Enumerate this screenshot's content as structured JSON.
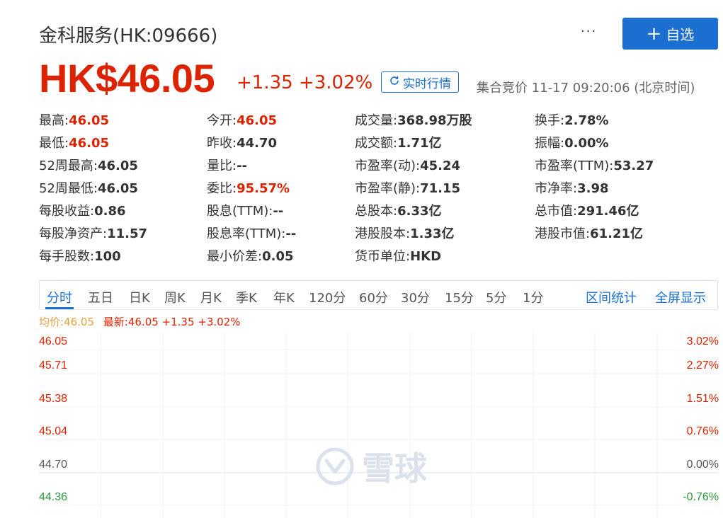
{
  "header": {
    "title": "金科服务(HK:09666)",
    "more": "···",
    "follow_plus": "+",
    "follow_label": "自选"
  },
  "quote": {
    "price": "HK$46.05",
    "change": "+1.35 +3.02%",
    "realtime_icon": "refresh-icon",
    "realtime_label": "实时行情",
    "auction_status": "集合竞价 11-17 09:20:06 (北京时间)"
  },
  "stats": [
    [
      {
        "label": "最高:",
        "value": "46.05",
        "color": "red"
      },
      {
        "label": "今开:",
        "value": "46.05",
        "color": "red"
      },
      {
        "label": "成交量:",
        "value": "368.98万股",
        "color": "normal"
      },
      {
        "label": "换手:",
        "value": "2.78%",
        "color": "normal"
      }
    ],
    [
      {
        "label": "最低:",
        "value": "46.05",
        "color": "red"
      },
      {
        "label": "昨收:",
        "value": "44.70",
        "color": "normal"
      },
      {
        "label": "成交额:",
        "value": "1.71亿",
        "color": "normal"
      },
      {
        "label": "振幅:",
        "value": "0.00%",
        "color": "normal"
      }
    ],
    [
      {
        "label": "52周最高:",
        "value": "46.05",
        "color": "normal"
      },
      {
        "label": "量比:",
        "value": "--",
        "color": "normal"
      },
      {
        "label": "市盈率(动):",
        "value": "45.24",
        "color": "normal"
      },
      {
        "label": "市盈率(TTM):",
        "value": "53.27",
        "color": "normal"
      }
    ],
    [
      {
        "label": "52周最低:",
        "value": "46.05",
        "color": "normal"
      },
      {
        "label": "委比:",
        "value": "95.57%",
        "color": "red"
      },
      {
        "label": "市盈率(静):",
        "value": "71.15",
        "color": "normal"
      },
      {
        "label": "市净率:",
        "value": "3.98",
        "color": "normal"
      }
    ],
    [
      {
        "label": "每股收益:",
        "value": "0.86",
        "color": "normal"
      },
      {
        "label": "股息(TTM):",
        "value": "--",
        "color": "normal"
      },
      {
        "label": "总股本:",
        "value": "6.33亿",
        "color": "normal"
      },
      {
        "label": "总市值:",
        "value": "291.46亿",
        "color": "normal"
      }
    ],
    [
      {
        "label": "每股净资产:",
        "value": "11.57",
        "color": "normal"
      },
      {
        "label": "股息率(TTM):",
        "value": "--",
        "color": "normal"
      },
      {
        "label": "港股股本:",
        "value": "1.33亿",
        "color": "normal"
      },
      {
        "label": "港股市值:",
        "value": "61.21亿",
        "color": "normal"
      }
    ],
    [
      {
        "label": "每手股数:",
        "value": "100",
        "color": "normal"
      },
      {
        "label": "最小价差:",
        "value": "0.05",
        "color": "normal"
      },
      {
        "label": "货币单位:",
        "value": "HKD",
        "color": "normal"
      }
    ]
  ],
  "tabs": {
    "items": [
      "分时",
      "五日",
      "日K",
      "周K",
      "月K",
      "季K",
      "年K",
      "120分",
      "60分",
      "30分",
      "15分",
      "5分",
      "1分"
    ],
    "active": "分时",
    "range_stats": "区间统计",
    "fullscreen": "全屏显示"
  },
  "legend": {
    "avg": "均价:46.05",
    "latest": "最新:46.05 +1.35 +3.02%"
  },
  "chart_data": {
    "type": "line",
    "title": "",
    "y_price_ticks": [
      "46.05",
      "45.71",
      "45.38",
      "45.04",
      "44.70",
      "44.36"
    ],
    "y_pct_ticks": [
      "3.02%",
      "2.27%",
      "1.51%",
      "0.76%",
      "0.00%",
      "-0.76%"
    ],
    "prev_close": 44.7,
    "series": []
  },
  "watermark": {
    "logo": "snowball-logo-icon",
    "text": "雪球"
  },
  "colors": {
    "up": "#dd2200",
    "down": "#2a9a3d",
    "accent": "#1a6fd0",
    "avg_line": "#e6a23c"
  }
}
